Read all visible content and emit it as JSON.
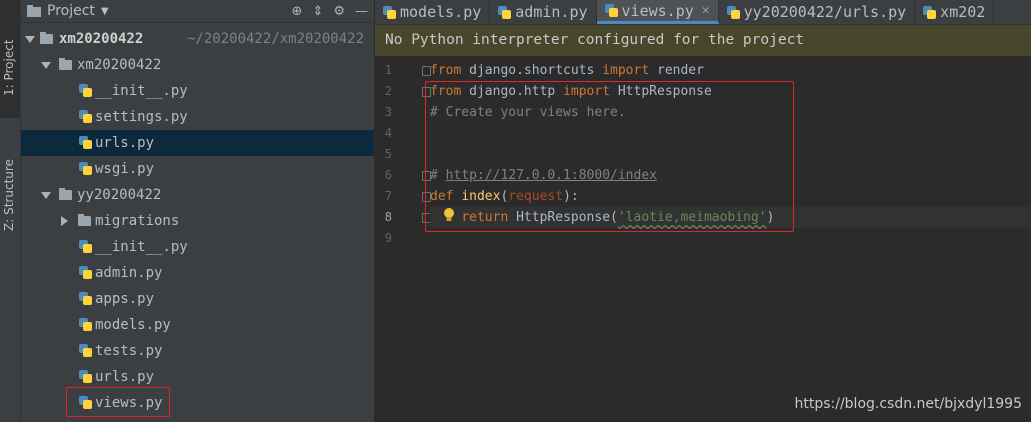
{
  "toolstrip": {
    "project_tab": "1: Project",
    "structure_tab": "Z: Structure"
  },
  "panel": {
    "title": "Project"
  },
  "tree": {
    "root_name": "xm20200422",
    "root_path": "~/20200422/xm20200422",
    "pkg1": "xm20200422",
    "pkg1_files": [
      "__init__.py",
      "settings.py",
      "urls.py",
      "wsgi.py"
    ],
    "pkg2": "yy20200422",
    "migrations": "migrations",
    "pkg2_files": [
      "__init__.py",
      "admin.py",
      "apps.py",
      "models.py",
      "tests.py",
      "urls.py",
      "views.py"
    ]
  },
  "tabs": [
    "models.py",
    "admin.py",
    "views.py",
    "yy20200422/urls.py",
    "xm202"
  ],
  "active_tab": "views.py",
  "banner": "No Python interpreter configured for the project",
  "code": {
    "line_numbers": [
      "1",
      "2",
      "3",
      "4",
      "5",
      "6",
      "7",
      "8",
      "9"
    ],
    "l1_kw1": "from",
    "l1_mod": " django.shortcuts ",
    "l1_kw2": "import",
    "l1_name": " render",
    "l2_kw1": "from",
    "l2_mod": " django.http ",
    "l2_kw2": "import",
    "l2_name": " HttpResponse",
    "l3_comment": "# Create your views here.",
    "l6_hash": "# ",
    "l6_url": "http://127.0.0.1:8000/index",
    "l7_kw": "def",
    "l7_fn": "index",
    "l7_open": "(",
    "l7_param": "request",
    "l7_close": "):",
    "l8_indent": "    ",
    "l8_kw": "return",
    "l8_call": " HttpResponse(",
    "l8_str": "'laotie,meimaobing'",
    "l8_close": ")"
  },
  "watermark": "https://blog.csdn.net/bjxdyl1995",
  "colors": {
    "banner_bg": "#49472b",
    "keyword": "#cc7832",
    "string": "#6a8759",
    "function": "#ffc66d",
    "highlight_box": "#e0262b"
  }
}
